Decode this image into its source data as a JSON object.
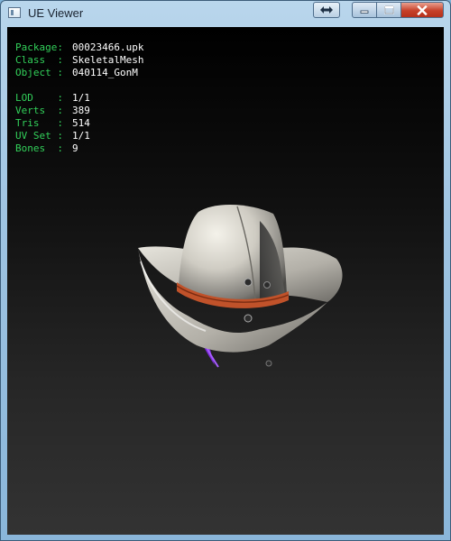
{
  "window": {
    "title": "UE Viewer",
    "icons": [
      "app-icon",
      "swap-icon",
      "minimize-icon",
      "maximize-icon",
      "close-icon"
    ]
  },
  "info": {
    "package": {
      "label": "Package:",
      "value": "00023466.upk"
    },
    "class": {
      "label": "Class  :",
      "value": "SkeletalMesh"
    },
    "object": {
      "label": "Object :",
      "value": "040114_GonM"
    },
    "lod": {
      "label": "LOD    :",
      "value": "1/1"
    },
    "verts": {
      "label": "Verts  :",
      "value": "389"
    },
    "tris": {
      "label": "Tris   :",
      "value": "514"
    },
    "uvset": {
      "label": "UV Set :",
      "value": "1/1"
    },
    "bones": {
      "label": "Bones  :",
      "value": "9"
    }
  },
  "colors": {
    "label_green": "#32d05a",
    "value_white": "#ffffff",
    "hat_band": "#c0522a",
    "feather": "#7a2ad6"
  }
}
